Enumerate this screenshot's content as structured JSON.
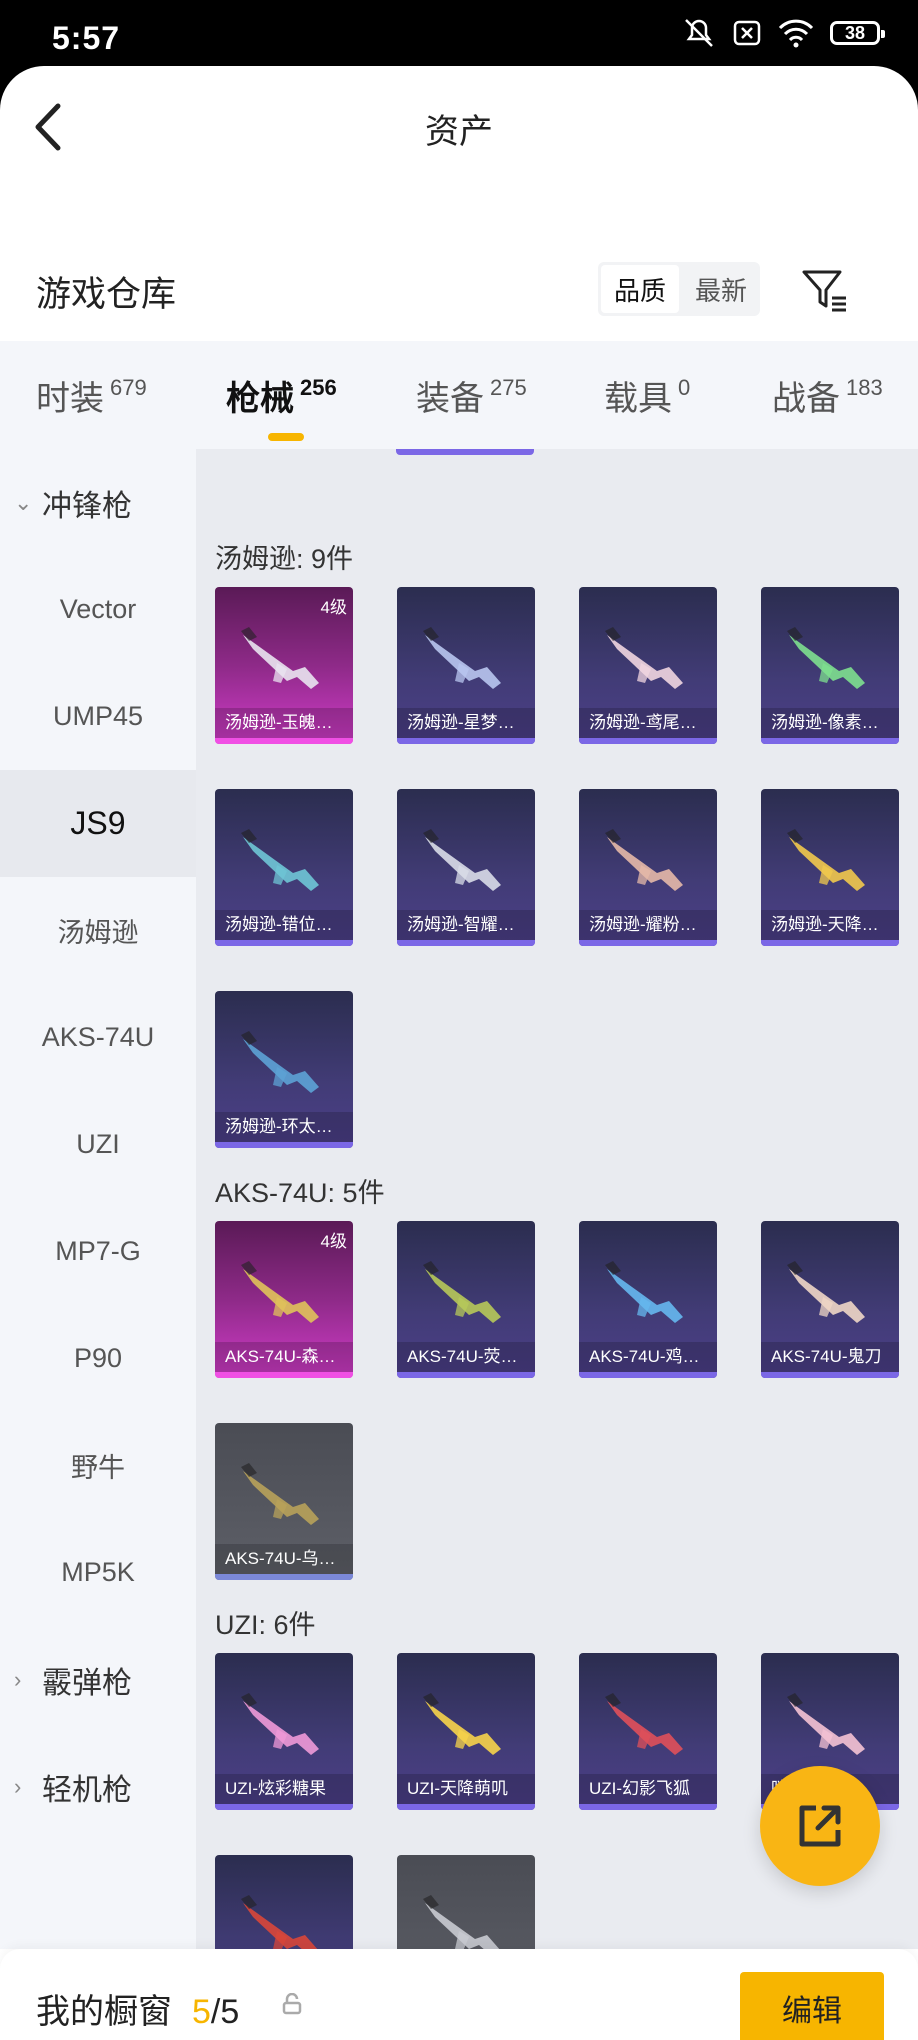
{
  "status": {
    "time": "5:57",
    "battery": "38"
  },
  "header": {
    "title": "资产"
  },
  "warehouse": {
    "title": "游戏仓库",
    "sort_options": [
      "品质",
      "最新"
    ]
  },
  "tabs": [
    {
      "label": "时装",
      "count": "679"
    },
    {
      "label": "枪械",
      "count": "256"
    },
    {
      "label": "装备",
      "count": "275"
    },
    {
      "label": "载具",
      "count": "0"
    },
    {
      "label": "战备",
      "count": "183"
    }
  ],
  "sidebar": {
    "groups": [
      "冲锋枪",
      "霰弹枪",
      "轻机枪"
    ],
    "items": [
      "Vector",
      "UMP45",
      "JS9",
      "汤姆逊",
      "AKS-74U",
      "UZI",
      "MP7-G",
      "P90",
      "野牛",
      "MP5K"
    ]
  },
  "sections": [
    {
      "title": "汤姆逊: 9件",
      "items": [
        {
          "label": "汤姆逊-玉魄…",
          "level": "4级",
          "rarity": "purple"
        },
        {
          "label": "汤姆逊-星梦…"
        },
        {
          "label": "汤姆逊-鸢尾…"
        },
        {
          "label": "汤姆逊-像素…"
        },
        {
          "label": "汤姆逊-错位…"
        },
        {
          "label": "汤姆逊-智耀…"
        },
        {
          "label": "汤姆逊-耀粉…"
        },
        {
          "label": "汤姆逊-天降…"
        },
        {
          "label": "汤姆逊-环太…"
        }
      ]
    },
    {
      "title": "AKS-74U: 5件",
      "items": [
        {
          "label": "AKS-74U-森…",
          "level": "4级",
          "rarity": "purple"
        },
        {
          "label": "AKS-74U-荧…"
        },
        {
          "label": "AKS-74U-鸡…"
        },
        {
          "label": "AKS-74U-鬼刀"
        },
        {
          "label": "AKS-74U-乌…",
          "rarity": "gray"
        }
      ]
    },
    {
      "title": "UZI: 6件",
      "items": [
        {
          "label": "UZI-炫彩糖果"
        },
        {
          "label": "UZI-天降萌叽"
        },
        {
          "label": "UZI-幻影飞狐"
        },
        {
          "label": "咪"
        },
        {
          "label": ""
        },
        {
          "label": "",
          "rarity": "gray"
        }
      ]
    }
  ],
  "bottom": {
    "showcase_label": "我的橱窗",
    "count_current": "5",
    "count_total": "/5",
    "edit_label": "编辑"
  },
  "colors": {
    "accent": "#f7b500",
    "card_bg": "#423c77",
    "card_purple": "#d03cc8"
  }
}
